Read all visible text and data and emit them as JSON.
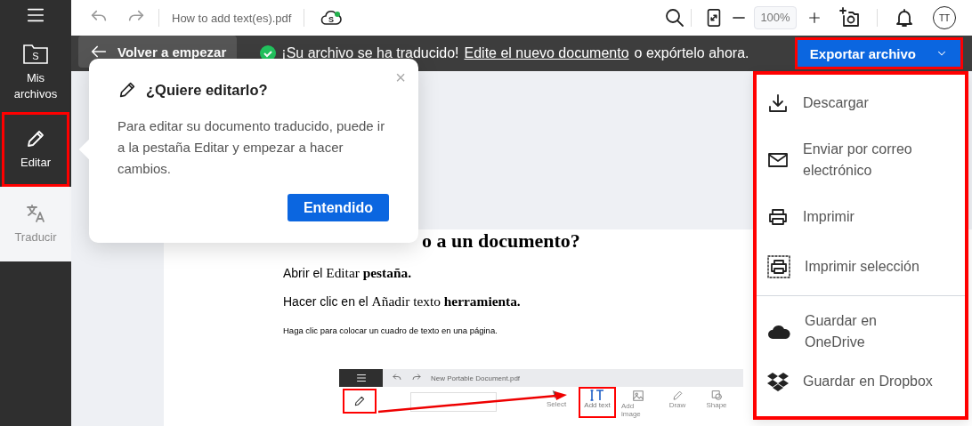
{
  "sidebar": {
    "items": [
      {
        "label": "Mis archivos",
        "icon_text": "S",
        "selected": false,
        "highlighted": false
      },
      {
        "label": "Editar",
        "selected": false,
        "highlighted": true
      },
      {
        "label": "Traducir",
        "selected": true,
        "highlighted": false
      }
    ]
  },
  "toolbar": {
    "file_name": "How to add text(es).pdf",
    "cloud_text": "S",
    "zoom": "100%",
    "avatar": "TT"
  },
  "banner": {
    "back_button": "Volver a empezar",
    "message": "¡Su archivo se ha traducido!",
    "link": "Edite el nuevo documento ",
    "suffix": "o expórtelo ahora.",
    "export_button": {
      "label": "Exportar archivo",
      "highlighted": true
    }
  },
  "popover": {
    "title": "¿Quiere editarlo?",
    "body": "Para editar su documento traducido, puede ir a la pestaña Editar y empezar a hacer cambios.",
    "button": "Entendido",
    "close": "×"
  },
  "document": {
    "heading": "o a un documento?",
    "lines": [
      {
        "kind": "step",
        "segments": [
          {
            "kind": "sans",
            "text": "Abrir el "
          },
          {
            "kind": "serif",
            "text": "Editar "
          },
          {
            "kind": "bold",
            "text": "pestaña."
          }
        ]
      },
      {
        "kind": "step",
        "segments": [
          {
            "kind": "sans",
            "text": "Hacer clic en el "
          },
          {
            "kind": "serif",
            "text": "Añadir texto "
          },
          {
            "kind": "bold",
            "text": "herramienta."
          }
        ]
      },
      {
        "kind": "note",
        "segments": [
          {
            "kind": "sans",
            "text": "Haga clic para colocar un cuadro de texto en una página."
          }
        ]
      }
    ],
    "embedded": {
      "file_name": "New Portable Document.pdf",
      "pencil_highlighted": true,
      "tools": [
        {
          "label": "Select",
          "highlighted": false
        },
        {
          "label": "Add text",
          "highlighted": true
        },
        {
          "label": "Add image",
          "highlighted": false
        },
        {
          "label": "Draw",
          "highlighted": false
        },
        {
          "label": "Shape",
          "highlighted": false
        }
      ]
    }
  },
  "export_menu": {
    "highlighted": true,
    "groups": [
      [
        {
          "label": "Descargar"
        },
        {
          "label": "Enviar por correo electrónico"
        },
        {
          "label": "Imprimir"
        },
        {
          "label": "Imprimir selección"
        }
      ],
      [
        {
          "label": "Guardar en OneDrive"
        },
        {
          "label": "Guardar en Dropbox"
        }
      ]
    ]
  }
}
